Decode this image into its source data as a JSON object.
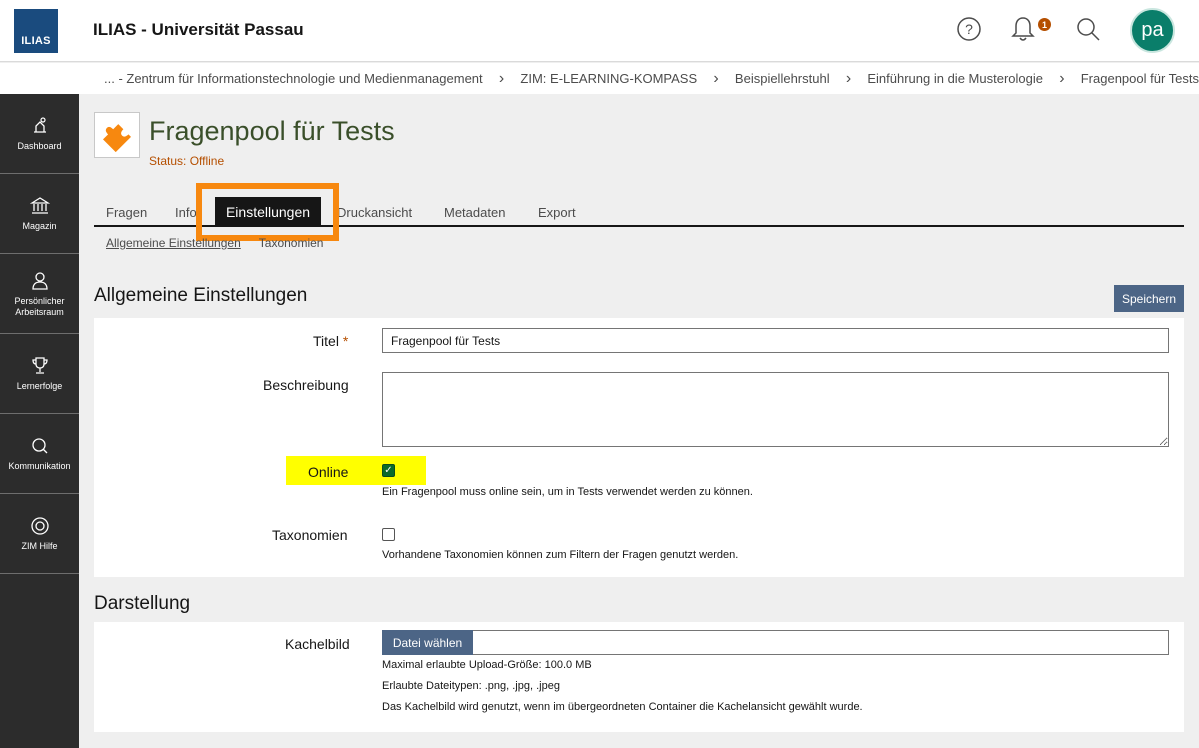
{
  "header": {
    "logo_text": "ILIAS",
    "site_title": "ILIAS - Universität Passau",
    "notification_count": "1",
    "avatar_initials": "pa"
  },
  "breadcrumb": [
    "... - Zentrum für Informationstechnologie und Medienmanagement",
    "ZIM: E-LEARNING-KOMPASS",
    "Beispiellehrstuhl",
    "Einführung in die Musterologie",
    "Fragenpool für Tests"
  ],
  "sidebar": {
    "items": [
      {
        "label": "Dashboard",
        "icon": "dashboard-icon"
      },
      {
        "label": "Magazin",
        "icon": "repository-icon"
      },
      {
        "label": "Persönlicher Arbeitsraum",
        "icon": "person-icon"
      },
      {
        "label": "Lernerfolge",
        "icon": "trophy-icon"
      },
      {
        "label": "Kommunikation",
        "icon": "chat-icon"
      },
      {
        "label": "ZIM Hilfe",
        "icon": "lifebuoy-icon"
      }
    ]
  },
  "page": {
    "title": "Fragenpool für Tests",
    "status": "Status: Offline"
  },
  "tabs": {
    "items": [
      "Fragen",
      "Info",
      "Einstellungen",
      "Druckansicht",
      "Metadaten",
      "Export"
    ],
    "active": "Einstellungen"
  },
  "subtabs": {
    "active": "Allgemeine Einstellungen",
    "other": "Taxonomien"
  },
  "general": {
    "section_title": "Allgemeine Einstellungen",
    "save_label": "Speichern",
    "title_label": "Titel",
    "required_mark": "*",
    "title_value": "Fragenpool für Tests",
    "description_label": "Beschreibung",
    "description_value": "",
    "online_label": "Online",
    "online_checked": true,
    "online_help": "Ein Fragenpool muss online sein, um in Tests verwendet werden zu können.",
    "taxonomy_label": "Taxonomien",
    "taxonomy_checked": false,
    "taxonomy_help": "Vorhandene Taxonomien können zum Filtern der Fragen genutzt werden."
  },
  "display": {
    "section_title": "Darstellung",
    "tile_label": "Kachelbild",
    "choose_file_label": "Datei wählen",
    "max_upload": "Maximal erlaubte Upload-Größe: 100.0 MB",
    "allowed_types": "Erlaubte Dateitypen: .png, .jpg, .jpeg",
    "tile_help": "Das Kachelbild wird genutzt, wenn im übergeordneten Container die Kachelansicht gewählt wurde."
  },
  "colors": {
    "accent_orange": "#f7880f",
    "highlight_yellow": "#ffff00",
    "button_blue": "#4c6586",
    "sidebar_dark": "#2c2c2c",
    "status_orange": "#b54f00"
  }
}
